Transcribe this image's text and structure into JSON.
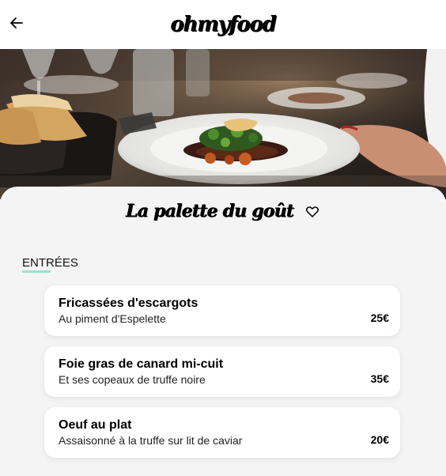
{
  "header": {
    "back_icon": "arrow-left-icon",
    "logo_text": "ohmyfood"
  },
  "hero": {
    "image_subject": "plated dish on restaurant table"
  },
  "restaurant": {
    "name": "La palette du goût",
    "favorite_icon": "heart-outline-icon"
  },
  "section": {
    "label": "ENTRÉES",
    "accent_color": "#99e2d0"
  },
  "menu": {
    "items": [
      {
        "name": "Fricassées d'escargots",
        "description": "Au piment d'Espelette",
        "price": "25€"
      },
      {
        "name": "Foie gras de canard mi-cuit",
        "description": "Et ses copeaux de truffe noire",
        "price": "35€"
      },
      {
        "name": "Oeuf au plat",
        "description": "Assaisonné à la truffe sur lit de caviar",
        "price": "20€"
      }
    ]
  }
}
